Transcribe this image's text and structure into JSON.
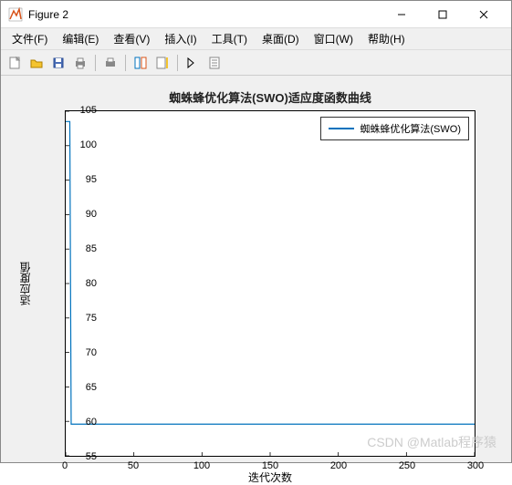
{
  "window": {
    "title": "Figure 2"
  },
  "menubar": {
    "file": "文件(F)",
    "edit": "编辑(E)",
    "view": "查看(V)",
    "insert": "插入(I)",
    "tools": "工具(T)",
    "desktop": "桌面(D)",
    "window": "窗口(W)",
    "help": "帮助(H)"
  },
  "chart_data": {
    "type": "line",
    "title": "蜘蛛蜂优化算法(SWO)适应度函数曲线",
    "xlabel": "迭代次数",
    "ylabel": "适应度值",
    "xlim": [
      0,
      300
    ],
    "ylim": [
      55,
      105
    ],
    "xticks": [
      0,
      50,
      100,
      150,
      200,
      250,
      300
    ],
    "yticks": [
      55,
      60,
      65,
      70,
      75,
      80,
      85,
      90,
      95,
      100,
      105
    ],
    "series": [
      {
        "name": "蜘蛛蜂优化算法(SWO)",
        "color": "#0072bd",
        "x": [
          0,
          1,
          2,
          3,
          4,
          5,
          6,
          7,
          8,
          9,
          10,
          300
        ],
        "y": [
          103.5,
          103.5,
          103.5,
          103.5,
          59.6,
          59.6,
          59.6,
          59.6,
          59.6,
          59.6,
          59.6,
          59.6
        ]
      }
    ],
    "legend": {
      "position": "top-right",
      "entries": [
        "蜘蛛蜂优化算法(SWO)"
      ]
    }
  },
  "watermark": "CSDN @Matlab程序猿"
}
